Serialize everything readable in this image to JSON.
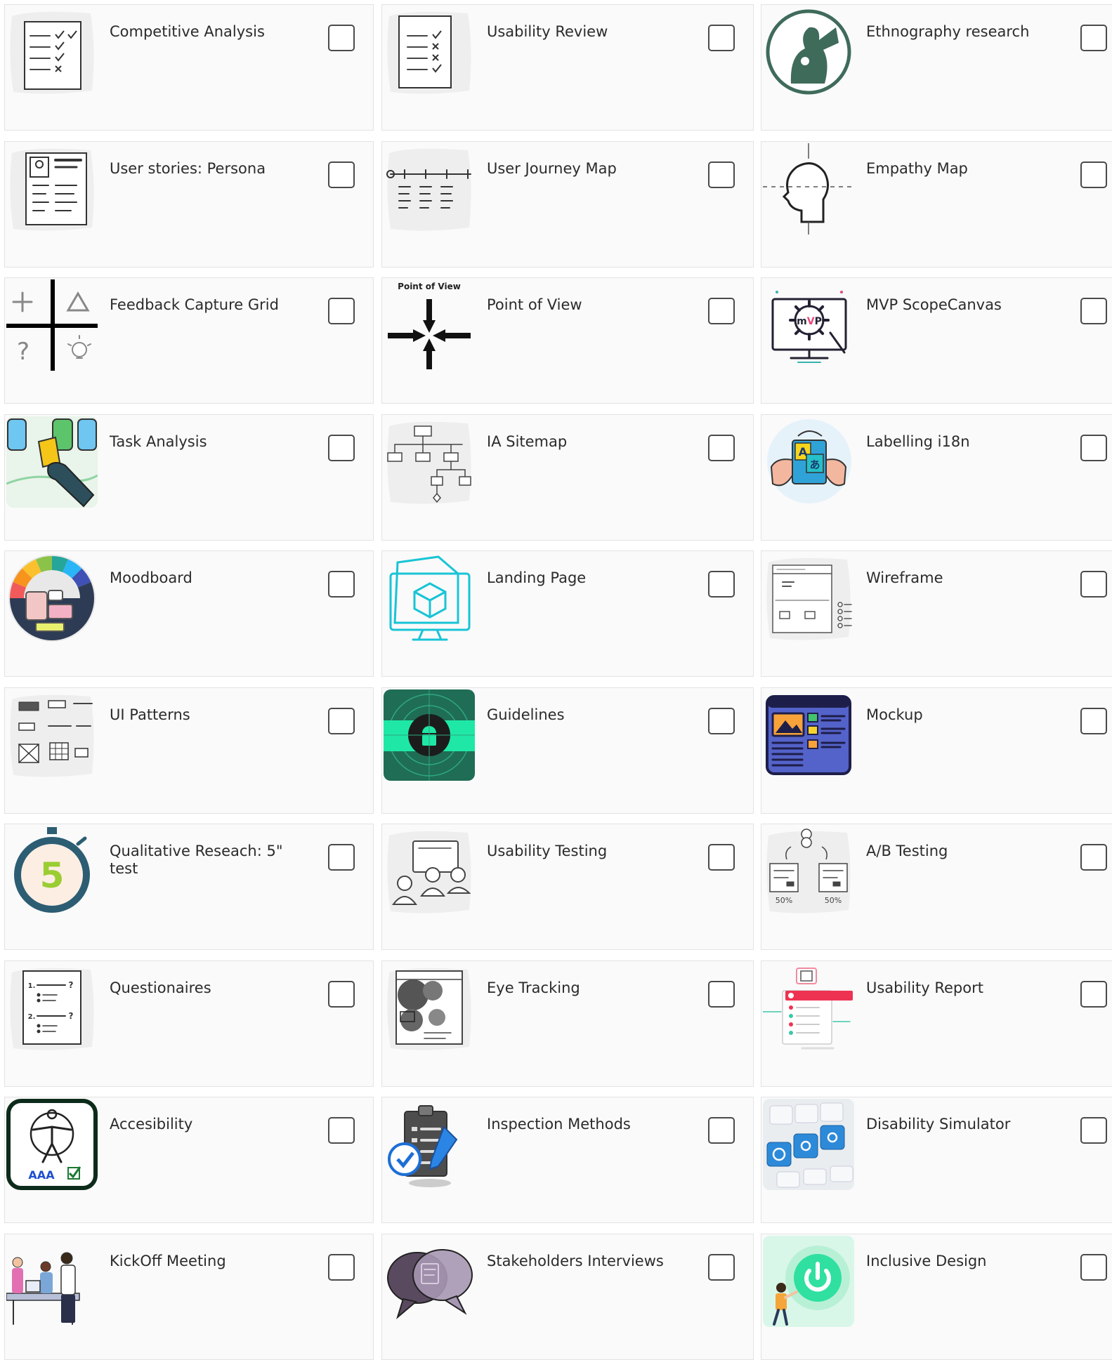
{
  "colors": {
    "card_background": "#fafafa",
    "card_border": "#e3e3e3",
    "label_text": "#2b2b2b",
    "checkbox_border": "#4a4a4a"
  },
  "cards": [
    {
      "label": "Competitive Analysis",
      "icon": "checklist-sketch-icon",
      "checked": false
    },
    {
      "label": "Usability Review",
      "icon": "review-checklist-icon",
      "checked": false
    },
    {
      "label": "Ethnography research",
      "icon": "ethnography-figure-icon",
      "checked": false
    },
    {
      "label": "User stories: Persona",
      "icon": "persona-card-icon",
      "checked": false
    },
    {
      "label": "User Journey Map",
      "icon": "journey-map-icon",
      "checked": false
    },
    {
      "label": "Empathy Map",
      "icon": "head-profile-icon",
      "checked": false
    },
    {
      "label": "Feedback Capture Grid",
      "icon": "feedback-grid-icon",
      "checked": false
    },
    {
      "label": "Point of View",
      "icon": "converging-arrows-icon",
      "checked": false,
      "icon_caption": "Point of View"
    },
    {
      "label": "MVP ScopeCanvas",
      "icon": "mvp-gear-monitor-icon",
      "checked": false,
      "icon_caption": "MVP"
    },
    {
      "label": "Task Analysis",
      "icon": "task-cards-hand-icon",
      "checked": false
    },
    {
      "label": "IA Sitemap",
      "icon": "sitemap-tree-icon",
      "checked": false
    },
    {
      "label": "Labelling i18n",
      "icon": "translation-phone-icon",
      "checked": false,
      "icon_caption": "A"
    },
    {
      "label": "Moodboard",
      "icon": "color-wheel-icon",
      "checked": false
    },
    {
      "label": "Landing Page",
      "icon": "monitor-cube-icon",
      "checked": false
    },
    {
      "label": "Wireframe",
      "icon": "wireframe-sketch-icon",
      "checked": false
    },
    {
      "label": "UI Patterns",
      "icon": "ui-patterns-sketch-icon",
      "checked": false
    },
    {
      "label": "Guidelines",
      "icon": "android-guidelines-icon",
      "checked": false
    },
    {
      "label": "Mockup",
      "icon": "mockup-browser-icon",
      "checked": false
    },
    {
      "label": "Qualitative Reseach: 5\" test",
      "icon": "stopwatch-five-icon",
      "checked": false,
      "icon_caption": "5"
    },
    {
      "label": "Usability Testing",
      "icon": "users-screen-icon",
      "checked": false
    },
    {
      "label": "A/B Testing",
      "icon": "ab-split-icon",
      "checked": false,
      "icon_caption": "50%"
    },
    {
      "label": "Questionaires",
      "icon": "questionnaire-sheet-icon",
      "checked": false
    },
    {
      "label": "Eye Tracking",
      "icon": "heatmap-page-icon",
      "checked": false
    },
    {
      "label": "Usability Report",
      "icon": "report-flow-icon",
      "checked": false
    },
    {
      "label": "Accesibility",
      "icon": "accessibility-aaa-icon",
      "checked": false,
      "icon_caption": "AAA"
    },
    {
      "label": "Inspection Methods",
      "icon": "clipboard-pen-icon",
      "checked": false
    },
    {
      "label": "Disability Simulator",
      "icon": "accessibility-keyboard-icon",
      "checked": false
    },
    {
      "label": "KickOff Meeting",
      "icon": "team-meeting-icon",
      "checked": false
    },
    {
      "label": "Stakeholders Interviews",
      "icon": "speech-bubbles-icon",
      "checked": false
    },
    {
      "label": "Inclusive Design",
      "icon": "power-button-icon",
      "checked": false
    }
  ]
}
